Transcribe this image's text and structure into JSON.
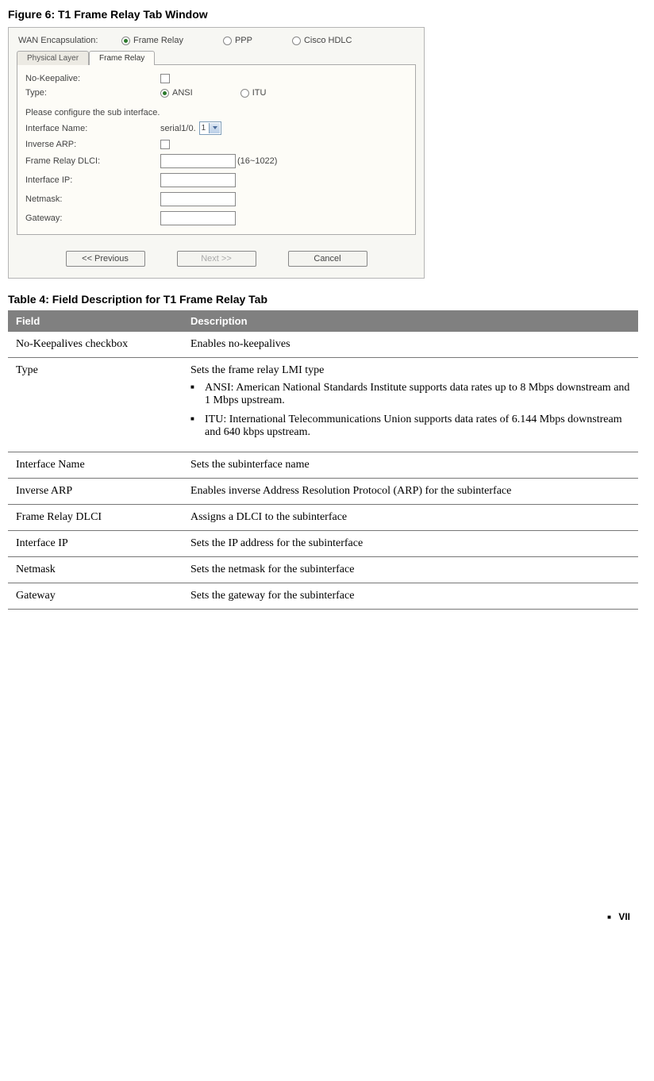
{
  "figure_title": "Figure 6:  T1 Frame Relay Tab Window",
  "window": {
    "wan_label": "WAN Encapsulation:",
    "wan_options": [
      "Frame Relay",
      "PPP",
      "Cisco HDLC"
    ],
    "tabs": [
      "Physical Layer",
      "Frame Relay"
    ],
    "no_keepalive_label": "No-Keepalive:",
    "type_label": "Type:",
    "type_options": [
      "ANSI",
      "ITU"
    ],
    "configure_note": "Please configure the sub interface.",
    "interface_name_label": "Interface Name:",
    "interface_name_prefix": "serial1/0.",
    "interface_name_value": "1",
    "inverse_arp_label": "Inverse ARP:",
    "dlci_label": "Frame Relay DLCI:",
    "dlci_range": "(16~1022)",
    "interface_ip_label": "Interface IP:",
    "netmask_label": "Netmask:",
    "gateway_label": "Gateway:",
    "btn_prev": "<< Previous",
    "btn_next": "Next >>",
    "btn_cancel": "Cancel"
  },
  "table_caption": "Table 4:  Field Description for T1 Frame Relay Tab",
  "table_headers": {
    "field": "Field",
    "desc": "Description"
  },
  "table_rows": {
    "r0": {
      "field": "No-Keepalives checkbox",
      "desc": "Enables no-keepalives"
    },
    "r1": {
      "field": "Type",
      "intro": "Sets the frame relay LMI type",
      "b1": "ANSI: American National Standards Institute supports data rates up to 8 Mbps downstream and 1 Mbps upstream.",
      "b2": "ITU: International Telecommunications Union supports data rates of 6.144 Mbps downstream and 640 kbps upstream."
    },
    "r2": {
      "field": "Interface Name",
      "desc": "Sets the subinterface name"
    },
    "r3": {
      "field": "Inverse ARP",
      "desc": "Enables inverse Address Resolution Protocol (ARP) for the subinterface"
    },
    "r4": {
      "field": "Frame Relay DLCI",
      "desc": "Assigns a DLCI to the subinterface"
    },
    "r5": {
      "field": "Interface IP",
      "desc": "Sets the IP address for the subinterface"
    },
    "r6": {
      "field": "Netmask",
      "desc": "Sets the netmask for the subinterface"
    },
    "r7": {
      "field": "Gateway",
      "desc": "Sets the gateway for the subinterface"
    }
  },
  "page_number": "VII"
}
